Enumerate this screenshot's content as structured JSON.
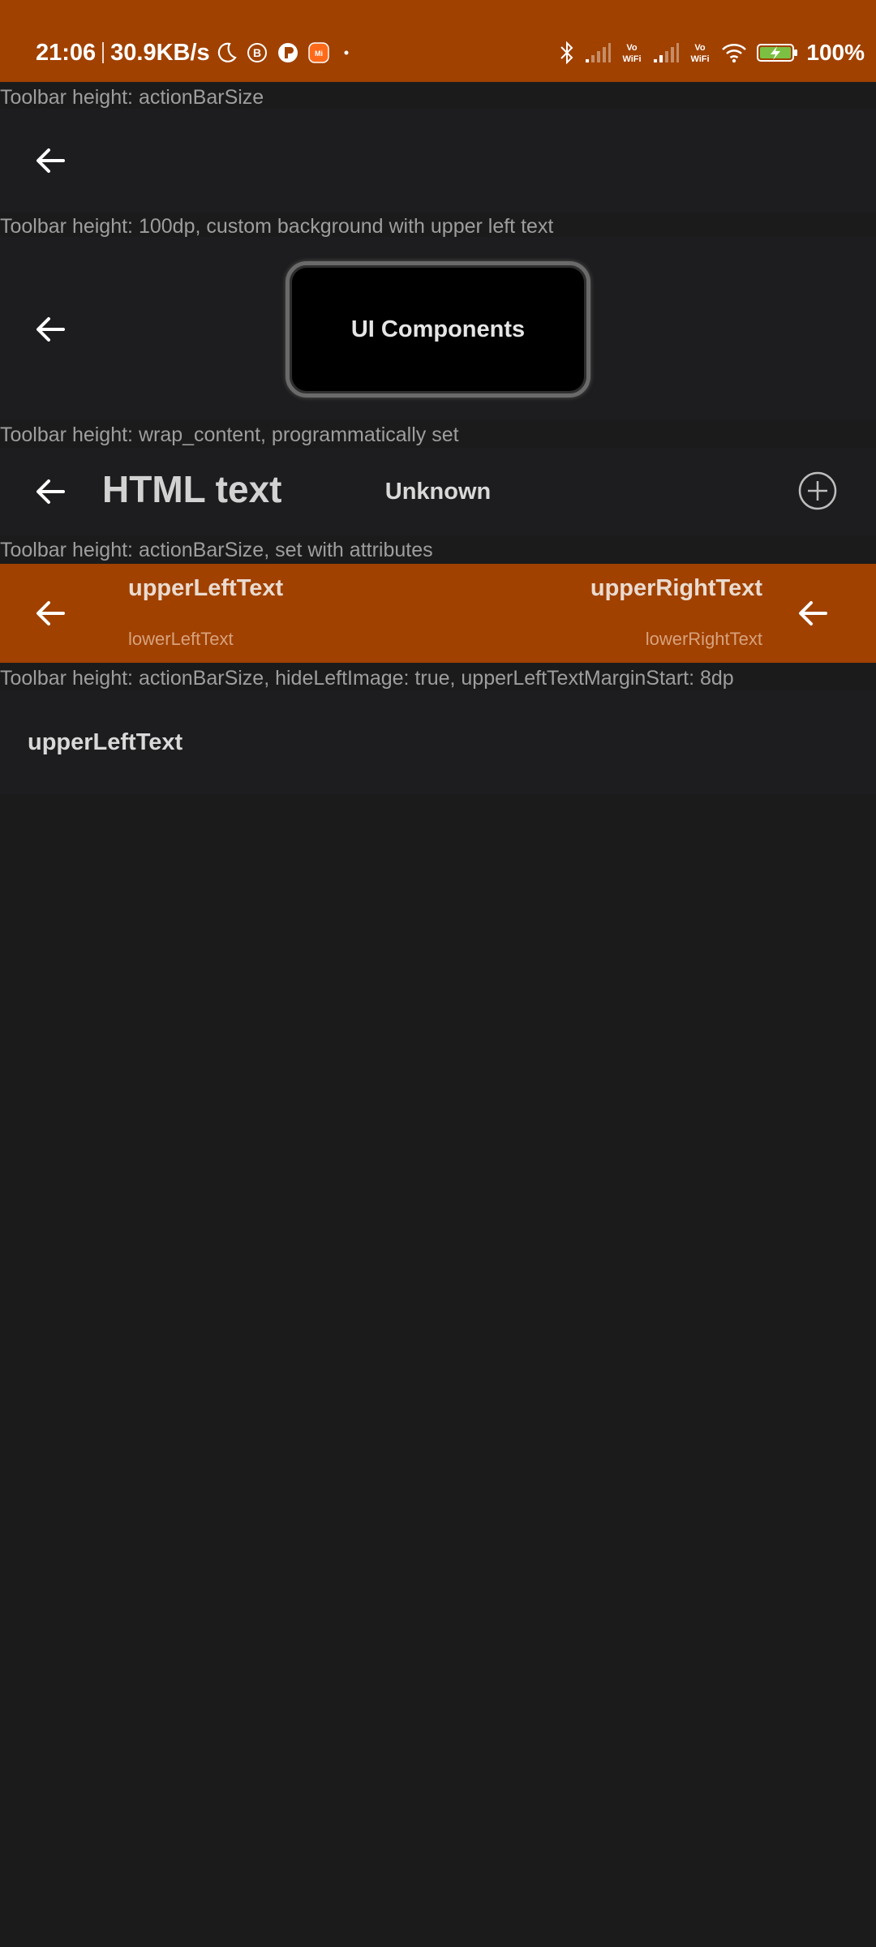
{
  "status_bar": {
    "time": "21:06",
    "speed": "30.9KB/s",
    "battery": "100%",
    "icons": [
      "moon-icon",
      "b-circle-icon",
      "app-icon",
      "mi-icon",
      "dot-icon",
      "bluetooth-icon",
      "signal-icon",
      "vowifi-icon",
      "signal-icon",
      "vowifi-icon",
      "wifi-icon",
      "battery-charging-icon"
    ],
    "background": "#a04100"
  },
  "sections": {
    "s1": {
      "caption": "Toolbar height: actionBarSize"
    },
    "s2": {
      "caption": "Toolbar height: 100dp, custom background with upper left text",
      "center_label": "UI Components"
    },
    "s3": {
      "caption": "Toolbar height: wrap_content, programmatically set",
      "title": "HTML text",
      "center_text": "Unknown"
    },
    "s4": {
      "caption": "Toolbar height: actionBarSize, set with attributes",
      "upper_left": "upperLeftText",
      "lower_left": "lowerLeftText",
      "upper_right": "upperRightText",
      "lower_right": "lowerRightText",
      "background": "#a04100"
    },
    "s5": {
      "caption": "Toolbar height: actionBarSize, hideLeftImage: true, upperLeftTextMarginStart: 8dp",
      "upper_left": "upperLeftText"
    }
  }
}
